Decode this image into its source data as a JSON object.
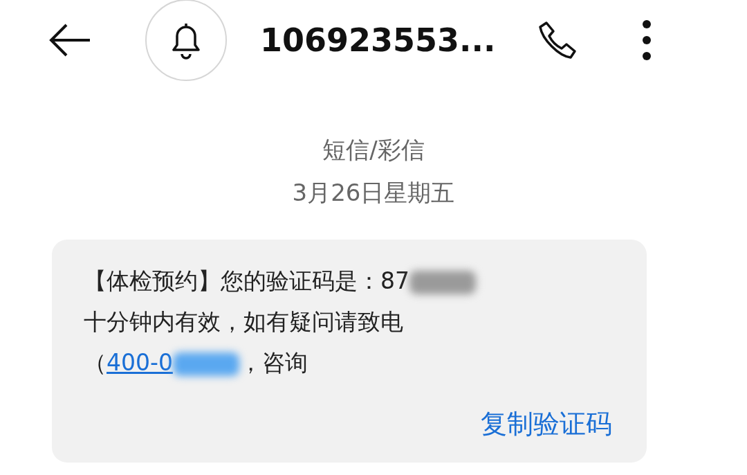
{
  "header": {
    "title": "106923553..."
  },
  "meta": {
    "channel": "短信/彩信",
    "date": "3月26日星期五"
  },
  "message": {
    "lines": [
      {
        "parts": [
          {
            "kind": "text",
            "text": "【体检预约】您的验证码是：87"
          },
          {
            "kind": "redacted",
            "color": "#9a9a9a"
          }
        ]
      },
      {
        "parts": [
          {
            "kind": "text",
            "text": "十分钟内有效，如有疑问请致电"
          }
        ]
      },
      {
        "parts": [
          {
            "kind": "text",
            "text": "（"
          },
          {
            "kind": "link",
            "text": "400-0"
          },
          {
            "kind": "redacted",
            "color": "#5aa8f0"
          },
          {
            "kind": "text",
            "text": "，咨询"
          }
        ]
      }
    ],
    "action": "复制验证码"
  }
}
